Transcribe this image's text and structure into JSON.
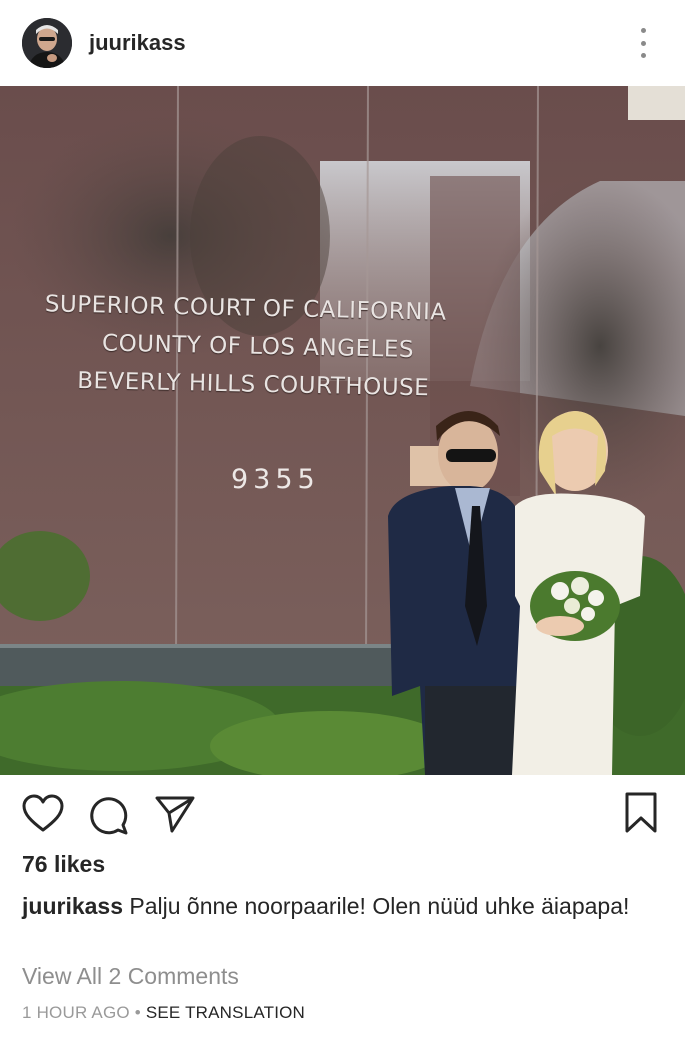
{
  "post": {
    "username": "juurikass",
    "more_icon": "more-vertical-icon",
    "photo": {
      "description_icon": "photo",
      "sign_lines": [
        "SUPERIOR COURT OF CALIFORNIA",
        "COUNTY OF LOS ANGELES",
        "BEVERLY HILLS COURTHOUSE"
      ],
      "street_number": "9355"
    },
    "actions": {
      "like_icon": "heart-icon",
      "comment_icon": "comment-icon",
      "share_icon": "send-icon",
      "save_icon": "bookmark-icon"
    },
    "likes": "76 likes",
    "caption_user": "juurikass",
    "caption_text": "Palju õnne noorpaarile! Olen nüüd uhke äiapapa!",
    "view_comments": "View All 2 Comments",
    "time_ago": "1 HOUR AGO",
    "separator": "•",
    "see_translation": "SEE TRANSLATION"
  },
  "colors": {
    "text": "#262626",
    "muted": "#8e8e8e",
    "wall": "#6e5250"
  }
}
